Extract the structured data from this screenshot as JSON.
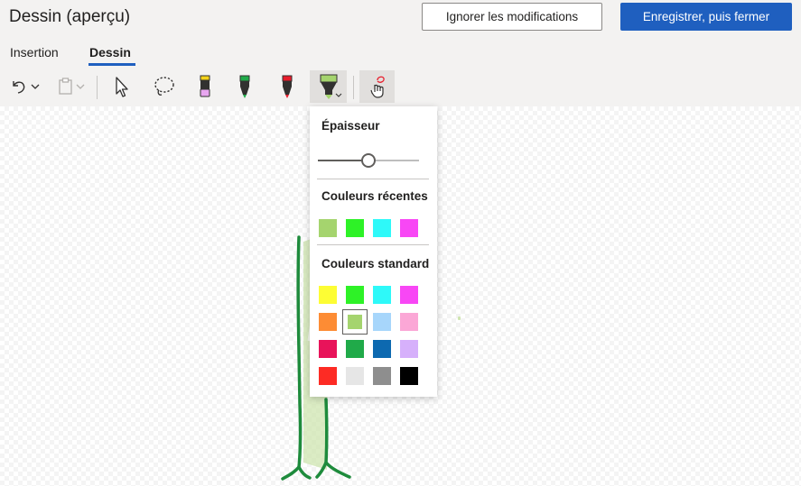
{
  "header": {
    "title": "Dessin (aperçu)",
    "discard_label": "Ignorer les modifications",
    "save_label": "Enregistrer, puis fermer"
  },
  "tabs": [
    {
      "label": "Insertion",
      "active": false
    },
    {
      "label": "Dessin",
      "active": true
    }
  ],
  "toolbar": {
    "tools": [
      "undo-icon",
      "chevron-down-icon",
      "paste-icon",
      "select-arrow-icon",
      "lasso-icon",
      "pencil-icon",
      "pen-green-icon",
      "pen-red-icon",
      "highlighter-icon",
      "ink-to-shape-icon"
    ],
    "selected_tool": "highlighter-icon"
  },
  "flyout": {
    "thickness_label": "Épaisseur",
    "thickness_value": 0.5,
    "recent_label": "Couleurs récentes",
    "standard_label": "Couleurs standard",
    "recent_colors": [
      "#a5d46e",
      "#2ef227",
      "#2ef9f9",
      "#f847f5"
    ],
    "standard_colors": [
      [
        "#fdfd34",
        "#2ef227",
        "#2ef9f9",
        "#f847f5"
      ],
      [
        "#fd8c34",
        "#a5d46e",
        "#a7d6fb",
        "#fba7d6"
      ],
      [
        "#e8135a",
        "#20aa49",
        "#0d69b0",
        "#d6b0fb"
      ],
      [
        "#fd2b24",
        "#e6e6e6",
        "#8e8e8e",
        "#000000"
      ]
    ],
    "selected_color": "#a5d46e"
  },
  "colors": {
    "accent": "#1f5fbf",
    "stroke_tree": "#1e8b3c",
    "highlight_fill": "#cfe5b0"
  }
}
